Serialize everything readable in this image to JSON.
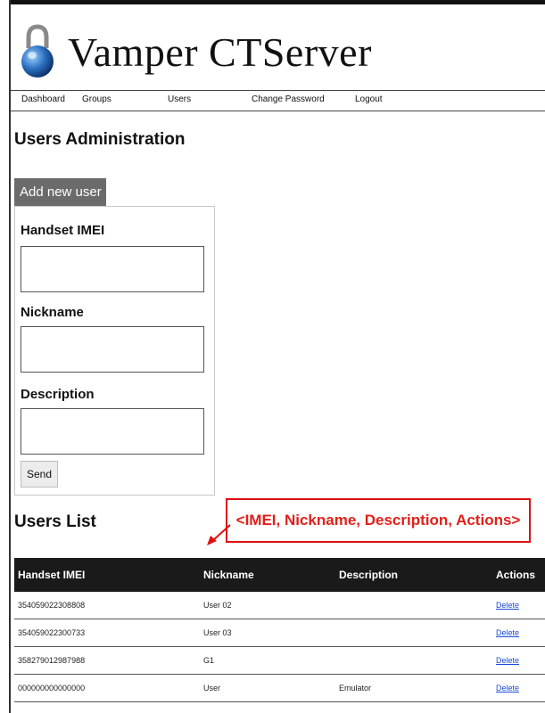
{
  "app": {
    "title": "Vamper CTServer",
    "logo_icon": "padlock-icon"
  },
  "nav": {
    "items": [
      {
        "label": "Dashboard"
      },
      {
        "label": "Groups"
      },
      {
        "label": "Users"
      },
      {
        "label": "Change Password"
      },
      {
        "label": "Logout"
      }
    ]
  },
  "page": {
    "title": "Users Administration"
  },
  "add_user": {
    "tab_label": "Add new user",
    "fields": {
      "imei": {
        "label": "Handset IMEI",
        "value": ""
      },
      "nickname": {
        "label": "Nickname",
        "value": ""
      },
      "description": {
        "label": "Description",
        "value": ""
      }
    },
    "send_label": "Send"
  },
  "users_list": {
    "title": "Users List",
    "callout": "<IMEI, Nickname, Description, Actions>",
    "callout_color": "#e0201a",
    "columns": [
      "Handset IMEI",
      "Nickname",
      "Description",
      "Actions"
    ],
    "rows": [
      {
        "imei": "354059022308808",
        "nickname": "User 02",
        "description": "",
        "action": "Delete"
      },
      {
        "imei": "354059022300733",
        "nickname": "User 03",
        "description": "",
        "action": "Delete"
      },
      {
        "imei": "358279012987988",
        "nickname": "G1",
        "description": "",
        "action": "Delete"
      },
      {
        "imei": "000000000000000",
        "nickname": "User",
        "description": "Emulator",
        "action": "Delete"
      }
    ]
  },
  "colors": {
    "header_bg": "#1a1a1a",
    "tab_bg": "#6b6b6b",
    "link": "#1a4bd8"
  }
}
